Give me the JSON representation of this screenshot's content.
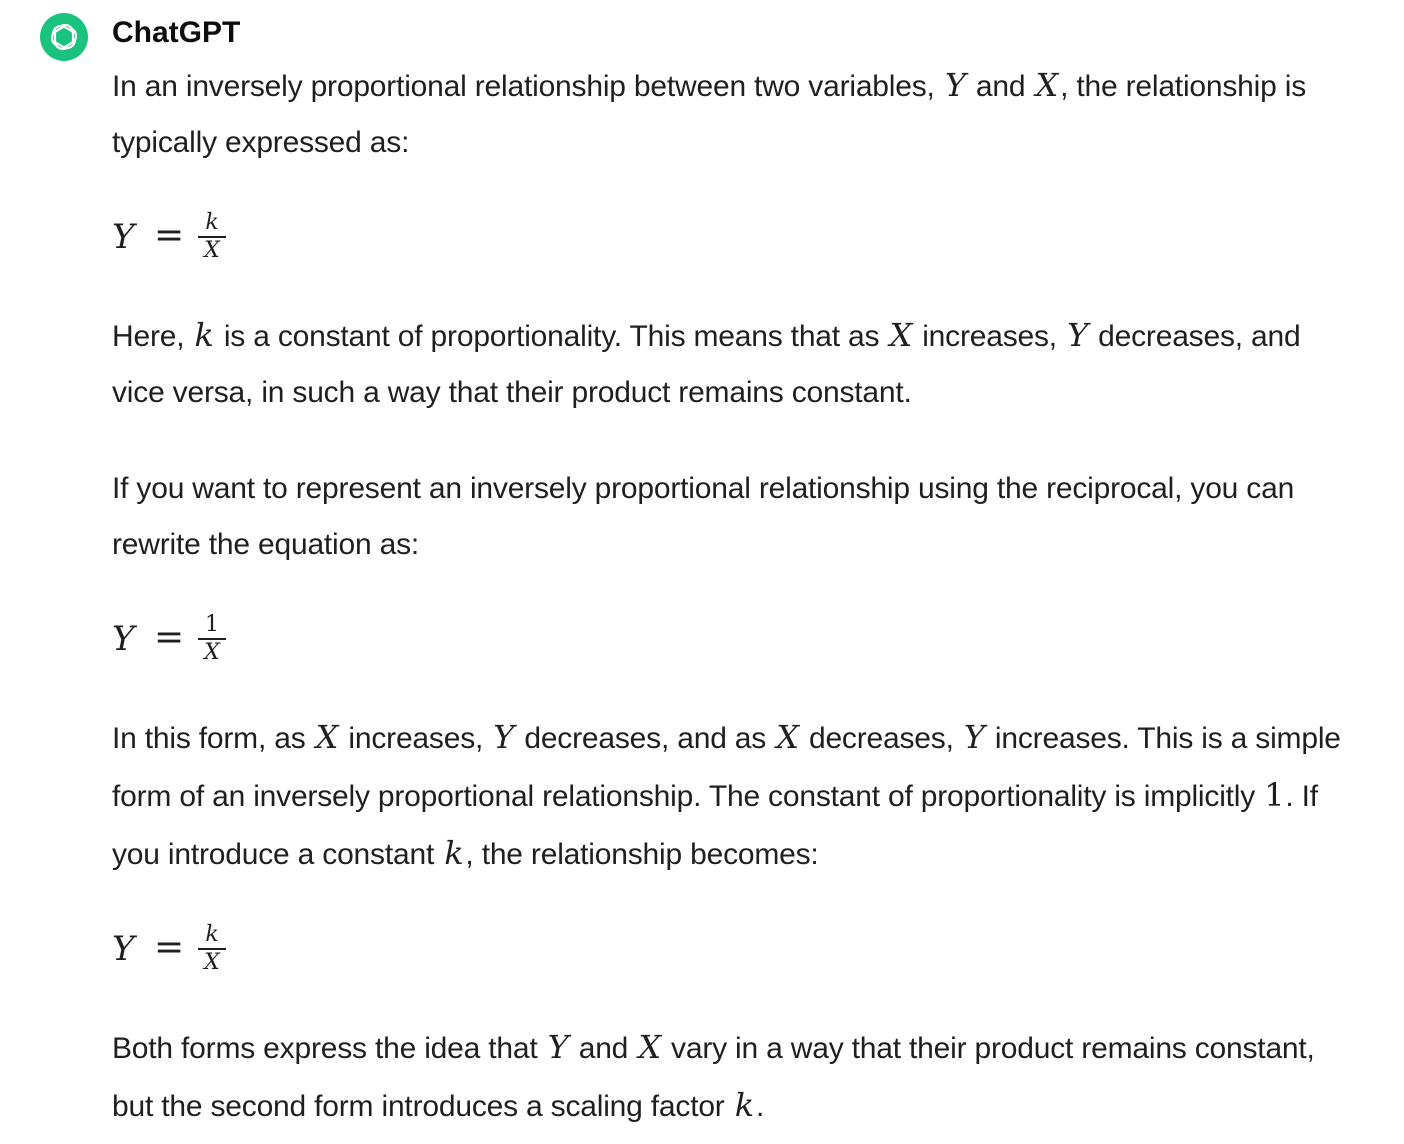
{
  "message": {
    "author": "ChatGPT",
    "avatar_icon": "openai-logo-icon",
    "avatar_color": "#19c37d"
  },
  "p1": {
    "t1": "In an inversely proportional relationship between two variables, ",
    "v1": "Y",
    "t2": " and ",
    "v2": "X",
    "t3": ", the relationship is typically expressed as:"
  },
  "eq1": {
    "lhs": "Y",
    "op": "=",
    "num": "k",
    "den": "X"
  },
  "p2": {
    "t1": "Here, ",
    "v1": "k",
    "t2": " is a constant of proportionality. This means that as ",
    "v2": "X",
    "t3": " increases, ",
    "v3": "Y",
    "t4": " decreases, and vice versa, in such a way that their product remains constant."
  },
  "p3": {
    "text": "If you want to represent an inversely proportional relationship using the reciprocal, you can rewrite the equation as:"
  },
  "eq2": {
    "lhs": "Y",
    "op": "=",
    "num": "1",
    "den": "X"
  },
  "p4": {
    "t1": "In this form, as ",
    "v1": "X",
    "t2": " increases, ",
    "v2": "Y",
    "t3": " decreases, and as ",
    "v3": "X",
    "t4": " decreases, ",
    "v4": "Y",
    "t5": " increases. This is a simple form of an inversely proportional relationship. The constant of proportionality is implicitly ",
    "n1": "1",
    "t6": ". If you introduce a constant ",
    "v5": "k",
    "t7": ", the relationship becomes:"
  },
  "eq3": {
    "lhs": "Y",
    "op": "=",
    "num": "k",
    "den": "X"
  },
  "p5": {
    "t1": "Both forms express the idea that ",
    "v1": "Y",
    "t2": " and ",
    "v2": "X",
    "t3": " vary in a way that their product remains constant, but the second form introduces a scaling factor ",
    "v3": "k",
    "t4": "."
  }
}
